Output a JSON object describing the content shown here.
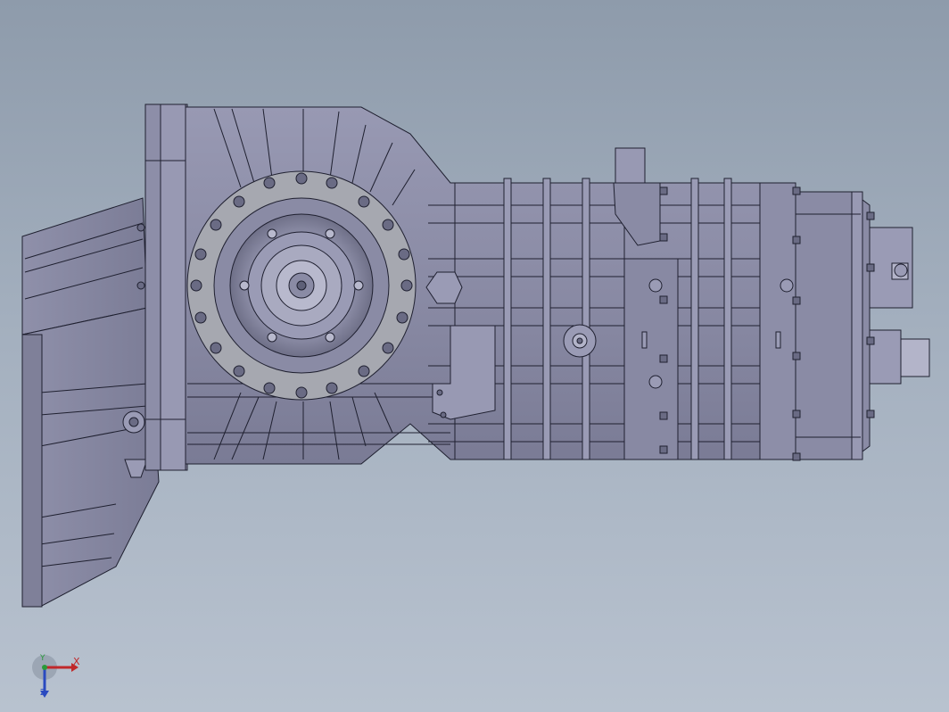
{
  "viewport": {
    "background_top": "#8e9bab",
    "background_bottom": "#b8c2cf"
  },
  "model": {
    "part_color": "#8d8ea8",
    "part_dark": "#5e6078",
    "part_light": "#a7a9c2",
    "edge_color": "#1f2030"
  },
  "triad": {
    "x_label": "X",
    "y_label": "Y",
    "z_label": "Z",
    "x_color": "#c0282a",
    "y_color": "#2a9a3a",
    "z_color": "#2a4ac0"
  }
}
